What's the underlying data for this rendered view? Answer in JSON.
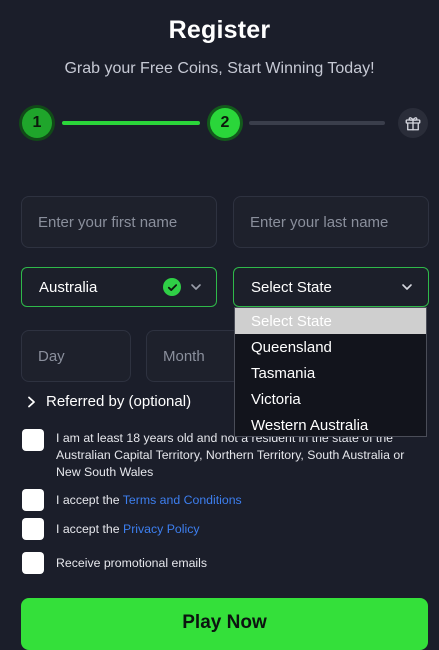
{
  "header": {
    "title": "Register",
    "subtitle": "Grab your Free Coins, Start Winning Today!"
  },
  "stepper": {
    "step1": "1",
    "step2": "2",
    "reward_icon": "gift-icon",
    "accent": "#2bd63a"
  },
  "form": {
    "first_name_placeholder": "Enter your first name",
    "last_name_placeholder": "Enter your last name",
    "country_value": "Australia",
    "state_value": "Select State",
    "day_placeholder": "Day",
    "month_placeholder": "Month"
  },
  "state_dropdown": {
    "options": [
      "Select State",
      "Queensland",
      "Tasmania",
      "Victoria",
      "Western Australia"
    ],
    "selected": "Select State"
  },
  "referred": {
    "label": "Referred by (optional)"
  },
  "checkboxes": {
    "age_text": "I am at least 18 years old and not a resident in the state of the Australian Capital Territory, Northern Territory, South Australia or New South Wales",
    "terms_prefix": "I accept the ",
    "terms_link": "Terms and Conditions",
    "privacy_prefix": "I accept the ",
    "privacy_link": "Privacy Policy",
    "promo_text": "Receive promotional emails"
  },
  "cta": {
    "play_label": "Play Now"
  }
}
